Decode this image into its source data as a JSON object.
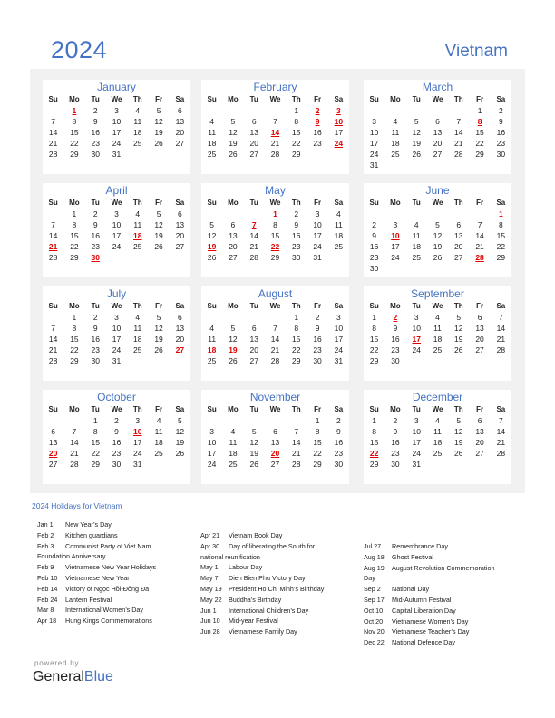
{
  "header": {
    "year": "2024",
    "country": "Vietnam"
  },
  "weekday_labels": [
    "Su",
    "Mo",
    "Tu",
    "We",
    "Th",
    "Fr",
    "Sa"
  ],
  "months": [
    {
      "name": "January",
      "start": 1,
      "days": 31,
      "holidays": [
        1
      ]
    },
    {
      "name": "February",
      "start": 4,
      "days": 29,
      "holidays": [
        2,
        3,
        9,
        10,
        14,
        24
      ]
    },
    {
      "name": "March",
      "start": 5,
      "days": 31,
      "holidays": [
        8
      ]
    },
    {
      "name": "April",
      "start": 1,
      "days": 30,
      "holidays": [
        18,
        21,
        30
      ]
    },
    {
      "name": "May",
      "start": 3,
      "days": 31,
      "holidays": [
        1,
        7,
        19,
        22
      ]
    },
    {
      "name": "June",
      "start": 6,
      "days": 30,
      "holidays": [
        1,
        10,
        28
      ]
    },
    {
      "name": "July",
      "start": 1,
      "days": 31,
      "holidays": [
        27
      ]
    },
    {
      "name": "August",
      "start": 4,
      "days": 31,
      "holidays": [
        18,
        19
      ]
    },
    {
      "name": "September",
      "start": 0,
      "days": 30,
      "holidays": [
        2,
        17
      ]
    },
    {
      "name": "October",
      "start": 2,
      "days": 31,
      "holidays": [
        10,
        20
      ]
    },
    {
      "name": "November",
      "start": 5,
      "days": 30,
      "holidays": [
        20
      ]
    },
    {
      "name": "December",
      "start": 0,
      "days": 31,
      "holidays": [
        22
      ]
    }
  ],
  "holidays_title": "2024 Holidays for Vietnam",
  "holiday_columns": [
    [
      {
        "date": "Jan 1",
        "name": "New Year’s Day"
      },
      {
        "date": "Feb 2",
        "name": "Kitchen guardians"
      },
      {
        "date": "Feb 3",
        "name": "Communist Party of Viet Nam"
      },
      {
        "date": "",
        "name": "Foundation Anniversary",
        "wrap": true
      },
      {
        "date": "Feb 9",
        "name": "Vietnamese New Year Holidays"
      },
      {
        "date": "Feb 10",
        "name": "Vietnamese New Year"
      },
      {
        "date": "Feb 14",
        "name": "Victory of Ngọc Hồi-Đống Đa"
      },
      {
        "date": "Feb 24",
        "name": "Lantern Festival"
      },
      {
        "date": "Mar 8",
        "name": "International Women’s Day"
      },
      {
        "date": "Apr 18",
        "name": "Hung Kings Commemorations"
      }
    ],
    [
      {
        "date": "Apr 21",
        "name": "Vietnam Book Day"
      },
      {
        "date": "Apr 30",
        "name": "Day of liberating the South for"
      },
      {
        "date": "",
        "name": "national reunification",
        "wrap": true
      },
      {
        "date": "May 1",
        "name": "Labour Day"
      },
      {
        "date": "May 7",
        "name": "Dien Bien Phu Victory Day"
      },
      {
        "date": "May 19",
        "name": "President Ho Chi Minh’s Birthday"
      },
      {
        "date": "May 22",
        "name": "Buddha’s Birthday"
      },
      {
        "date": "Jun 1",
        "name": "International Children’s Day"
      },
      {
        "date": "Jun 10",
        "name": "Mid-year Festival"
      },
      {
        "date": "Jun 28",
        "name": "Vietnamese Family Day"
      }
    ],
    [
      {
        "date": "Jul 27",
        "name": "Remembrance Day"
      },
      {
        "date": "Aug 18",
        "name": "Ghost Festival"
      },
      {
        "date": "Aug 19",
        "name": "August Revolution Commemoration"
      },
      {
        "date": "",
        "name": "Day",
        "wrap": true
      },
      {
        "date": "Sep 2",
        "name": "National Day"
      },
      {
        "date": "Sep 17",
        "name": "Mid-Autumn Festival"
      },
      {
        "date": "Oct 10",
        "name": "Capital Liberation Day"
      },
      {
        "date": "Oct 20",
        "name": "Vietnamese Women’s Day"
      },
      {
        "date": "Nov 20",
        "name": "Vietnamese Teacher’s Day"
      },
      {
        "date": "Dec 22",
        "name": "National Defence Day"
      }
    ]
  ],
  "footer": {
    "powered_by": "powered by",
    "brand_part1": "General",
    "brand_part2": "Blue"
  },
  "colors": {
    "accent": "#4472c4",
    "holiday": "#e00000",
    "panel": "#f1f1f1"
  }
}
